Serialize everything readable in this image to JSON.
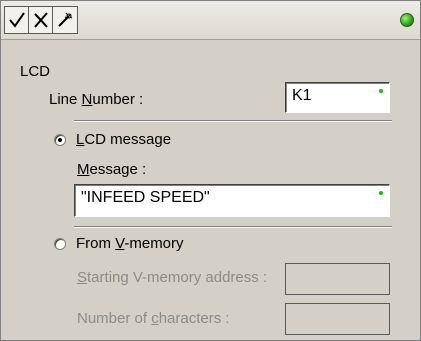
{
  "toolbar": {
    "accept_icon": "check-icon",
    "cancel_icon": "x-icon",
    "help_icon": "wand-icon",
    "status_color": "#2ea11b"
  },
  "section_title": "LCD",
  "line_number": {
    "label_pre": "Line ",
    "label_key": "N",
    "label_post": "umber :",
    "value": "K1"
  },
  "lcd_message_option": {
    "label_key": "L",
    "label_post": "CD message",
    "selected": true
  },
  "message": {
    "label_key": "M",
    "label_post": "essage :",
    "value": "\"INFEED SPEED\""
  },
  "vmemory_option": {
    "label_pre": "From ",
    "label_key": "V",
    "label_post": "-memory",
    "selected": false
  },
  "start_address": {
    "label_key": "S",
    "label_post": "tarting V-memory address :",
    "value": ""
  },
  "num_chars": {
    "label_pre": "Number of ",
    "label_key": "c",
    "label_post": "haracters :",
    "value": ""
  }
}
